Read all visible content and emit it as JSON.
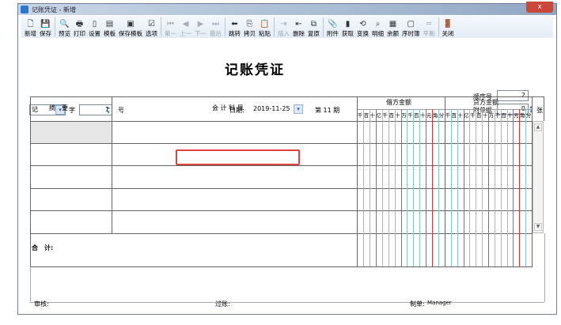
{
  "window": {
    "title": "记账凭证 - 新增",
    "close": "x"
  },
  "toolbar": [
    {
      "label": "新增",
      "icon": "new-doc-icon",
      "glyph": "🗋",
      "enabled": true
    },
    {
      "label": "保存",
      "icon": "save-icon",
      "glyph": "💾",
      "enabled": true
    },
    {
      "sep": true
    },
    {
      "label": "预览",
      "icon": "preview-icon",
      "glyph": "🔍",
      "enabled": true
    },
    {
      "label": "打印",
      "icon": "print-icon",
      "glyph": "🖶",
      "enabled": true
    },
    {
      "label": "设置",
      "icon": "settings-icon",
      "glyph": "▯",
      "enabled": true
    },
    {
      "label": "模板",
      "icon": "template-icon",
      "glyph": "▤",
      "enabled": true
    },
    {
      "label": "保存模板",
      "icon": "save-template-icon",
      "glyph": "▣",
      "enabled": true
    },
    {
      "label": "选项",
      "icon": "options-icon",
      "glyph": "☑",
      "enabled": true
    },
    {
      "sep": true
    },
    {
      "label": "第一",
      "icon": "first-icon",
      "glyph": "⏮",
      "enabled": false
    },
    {
      "label": "上一",
      "icon": "prev-icon",
      "glyph": "◀",
      "enabled": false
    },
    {
      "label": "下一",
      "icon": "next-icon",
      "glyph": "▶",
      "enabled": false
    },
    {
      "label": "最后",
      "icon": "last-icon",
      "glyph": "⏭",
      "enabled": false
    },
    {
      "sep": true
    },
    {
      "label": "跳转",
      "icon": "jump-icon",
      "glyph": "⬅",
      "enabled": true
    },
    {
      "label": "拷贝",
      "icon": "copy-icon",
      "glyph": "⎘",
      "enabled": true
    },
    {
      "label": "粘贴",
      "icon": "paste-icon",
      "glyph": "📋",
      "enabled": true
    },
    {
      "sep": true
    },
    {
      "label": "插入",
      "icon": "insert-icon",
      "glyph": "⇥",
      "enabled": false
    },
    {
      "label": "删除",
      "icon": "delete-icon",
      "glyph": "⇤",
      "enabled": true
    },
    {
      "label": "复原",
      "icon": "restore-icon",
      "glyph": "⧉",
      "enabled": true
    },
    {
      "sep": true
    },
    {
      "label": "附件",
      "icon": "attachment-icon",
      "glyph": "📎",
      "enabled": true
    },
    {
      "label": "获取",
      "icon": "fetch-icon",
      "glyph": "▮",
      "enabled": true
    },
    {
      "label": "变换",
      "icon": "transform-icon",
      "glyph": "⟲",
      "enabled": true
    },
    {
      "label": "明细",
      "icon": "binoculars-icon",
      "glyph": "⌕",
      "enabled": true
    },
    {
      "label": "余额",
      "icon": "balance-icon",
      "glyph": "▦",
      "enabled": true
    },
    {
      "label": "序时簿",
      "icon": "journal-icon",
      "glyph": "▢",
      "enabled": true
    },
    {
      "label": "平衡",
      "icon": "balance-check-icon",
      "glyph": "═",
      "enabled": false
    },
    {
      "sep": true
    },
    {
      "label": "关闭",
      "icon": "close-door-icon",
      "glyph": "🚪",
      "enabled": true
    }
  ],
  "form": {
    "heading": "记账凭证",
    "voucher_type": "记",
    "zi": "字",
    "number": "1",
    "hao": "号",
    "date_label": "日期:",
    "date": "2019-11-25",
    "period": "第 11 期",
    "seq_label": "顺序号",
    "seq": "2",
    "attach_label": "附单据",
    "attach": "0",
    "attach_unit": "张"
  },
  "table": {
    "col_summary": "摘　要",
    "col_account": "会 计 科 目",
    "col_debit": "借方金额",
    "col_credit": "贷方金额",
    "digits": [
      "千",
      "百",
      "十",
      "亿",
      "千",
      "百",
      "十",
      "万",
      "千",
      "百",
      "十",
      "元",
      "角",
      "分"
    ],
    "rows": 5,
    "total_label": "合　计:"
  },
  "footer": {
    "audit": "审核:",
    "post": "过账:",
    "maker_label": "制单:",
    "maker": "Manager"
  }
}
